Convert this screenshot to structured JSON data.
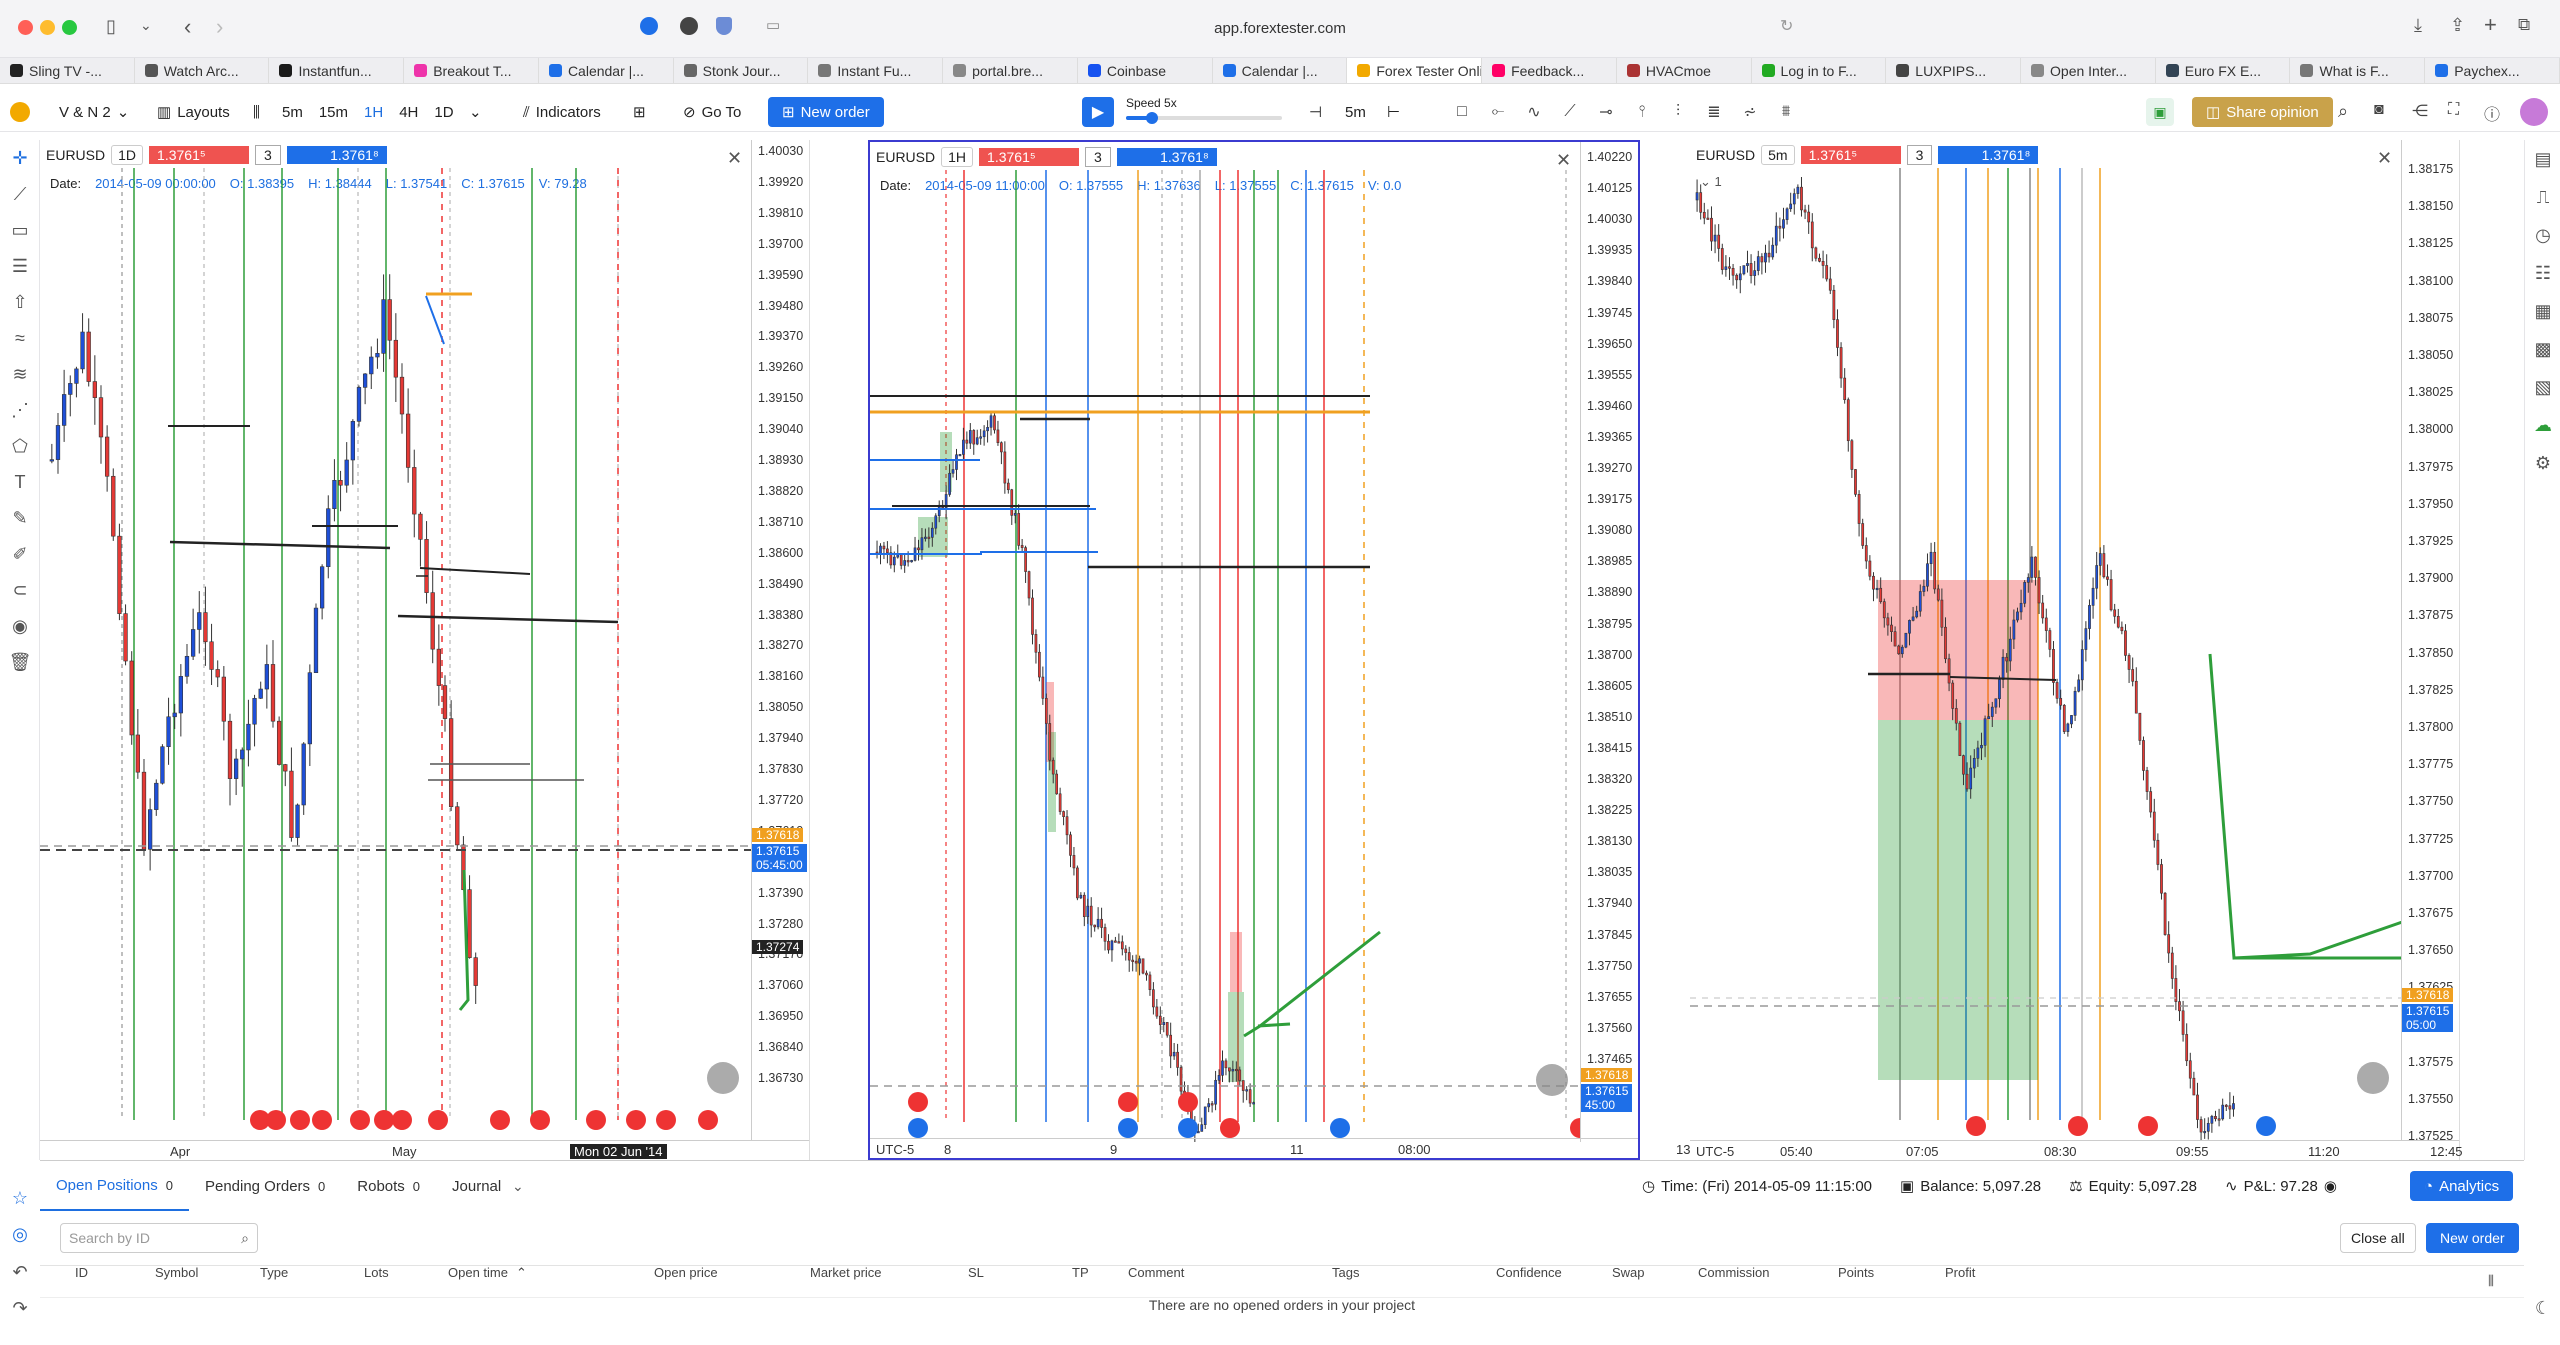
{
  "browser": {
    "url": "app.forextester.com",
    "tabs": [
      {
        "label": "Sling TV -..."
      },
      {
        "label": "Watch Arc..."
      },
      {
        "label": "Instantfun..."
      },
      {
        "label": "Breakout T..."
      },
      {
        "label": "Calendar |..."
      },
      {
        "label": "Stonk Jour..."
      },
      {
        "label": "Instant Fu..."
      },
      {
        "label": "portal.bre..."
      },
      {
        "label": "Coinbase"
      },
      {
        "label": "Calendar |..."
      },
      {
        "label": "Forex Tester Online"
      },
      {
        "label": "Feedback..."
      },
      {
        "label": "HVACmoe"
      },
      {
        "label": "Log in to F..."
      },
      {
        "label": "LUXPIPS..."
      },
      {
        "label": "Open Inter..."
      },
      {
        "label": "Euro FX E..."
      },
      {
        "label": "What is F..."
      },
      {
        "label": "Paychex..."
      }
    ]
  },
  "toolbar": {
    "layout_name": "V & N 2",
    "layouts_label": "Layouts",
    "timeframes": [
      "5m",
      "15m",
      "1H",
      "4H",
      "1D"
    ],
    "active_timeframe": "1H",
    "indicators_label": "Indicators",
    "goto_label": "Go To",
    "new_order_label": "New order",
    "speed_label": "Speed 5x",
    "step_label": "5m",
    "share_label": "Share opinion"
  },
  "charts": [
    {
      "symbol": "EURUSD",
      "timeframe": "1D",
      "bid": "1.3761⁵",
      "spread": "3",
      "ask": "1.3761⁸",
      "date_label": "Date:",
      "date": "2014-05-09 00:00:00",
      "open": "O: 1.38395",
      "high": "H: 1.38444",
      "low": "L: 1.37541",
      "close": "C: 1.37615",
      "volume": "V: 79.28",
      "price_ticks": [
        "1.40030",
        "1.39920",
        "1.39810",
        "1.39700",
        "1.39590",
        "1.39480",
        "1.39370",
        "1.39260",
        "1.39150",
        "1.39040",
        "1.38930",
        "1.38820",
        "1.38710",
        "1.38600",
        "1.38490",
        "1.38380",
        "1.38270",
        "1.38160",
        "1.38050",
        "1.37940",
        "1.37830",
        "1.37720",
        "1.37610",
        "1.37500",
        "1.37390",
        "1.37280",
        "1.37170",
        "1.37060",
        "1.36950",
        "1.36840",
        "1.36730"
      ],
      "time_labels": [
        "Apr",
        "May",
        "Mon 02 Jun '14"
      ],
      "current_price_tag": "1.37618",
      "current_close_tag": "1.37615",
      "countdown": "05:45:00",
      "level_tag": "1.37274"
    },
    {
      "symbol": "EURUSD",
      "timeframe": "1H",
      "bid": "1.3761⁵",
      "spread": "3",
      "ask": "1.3761⁸",
      "date_label": "Date:",
      "date": "2014-05-09 11:00:00",
      "open": "O: 1.37555",
      "high": "H: 1.37636",
      "low": "L: 1.37555",
      "close": "C: 1.37615",
      "volume": "V: 0.0",
      "price_ticks": [
        "1.40220",
        "1.40125",
        "1.40030",
        "1.39935",
        "1.39840",
        "1.39745",
        "1.39650",
        "1.39555",
        "1.39460",
        "1.39365",
        "1.39270",
        "1.39175",
        "1.39080",
        "1.38985",
        "1.38890",
        "1.38795",
        "1.38700",
        "1.38605",
        "1.38510",
        "1.38415",
        "1.38320",
        "1.38225",
        "1.38130",
        "1.38035",
        "1.37940",
        "1.37845",
        "1.37750",
        "1.37655",
        "1.37560",
        "1.37465"
      ],
      "time_labels": [
        "UTC-5",
        "8",
        "9",
        "11",
        "08:00",
        "13"
      ],
      "current_price_tag": "1.37618",
      "current_close_tag": "1.37615",
      "countdown": "45:00"
    },
    {
      "symbol": "EURUSD",
      "timeframe": "5m",
      "bid": "1.3761⁵",
      "spread": "3",
      "ask": "1.3761⁸",
      "price_ticks": [
        "1.38175",
        "1.38150",
        "1.38125",
        "1.38100",
        "1.38075",
        "1.38050",
        "1.38025",
        "1.38000",
        "1.37975",
        "1.37950",
        "1.37925",
        "1.37900",
        "1.37875",
        "1.37850",
        "1.37825",
        "1.37800",
        "1.37775",
        "1.37750",
        "1.37725",
        "1.37700",
        "1.37675",
        "1.37650",
        "1.37625",
        "1.37600",
        "1.37575",
        "1.37550",
        "1.37525"
      ],
      "time_labels": [
        "UTC-5",
        "05:40",
        "07:05",
        "08:30",
        "09:55",
        "11:20",
        "12:45"
      ],
      "current_price_tag": "1.37618",
      "current_close_tag": "1.37615",
      "countdown": "05:00"
    }
  ],
  "status": {
    "time": "Time: (Fri) 2014-05-09 11:15:00",
    "balance": "Balance: 5,097.28",
    "equity": "Equity: 5,097.28",
    "pnl": "P&L: 97.28",
    "analytics_label": "Analytics"
  },
  "positions": {
    "tabs": [
      {
        "label": "Open Positions",
        "count": "0"
      },
      {
        "label": "Pending Orders",
        "count": "0"
      },
      {
        "label": "Robots",
        "count": "0"
      },
      {
        "label": "Journal",
        "count": ""
      }
    ],
    "search_placeholder": "Search by ID",
    "close_all_label": "Close all",
    "new_order_label": "New order",
    "columns": [
      "ID",
      "Symbol",
      "Type",
      "Lots",
      "Open time",
      "Open price",
      "Market price",
      "SL",
      "TP",
      "Comment",
      "Tags",
      "Confidence",
      "Swap",
      "Commission",
      "Points",
      "Profit"
    ],
    "empty_message": "There are no opened orders in your project"
  },
  "colors": {
    "bull": "#1e4fd8",
    "bear": "#e53935",
    "accent": "#1e6fe8",
    "level_green": "#2e9e3a",
    "level_orange": "#f0a020"
  }
}
